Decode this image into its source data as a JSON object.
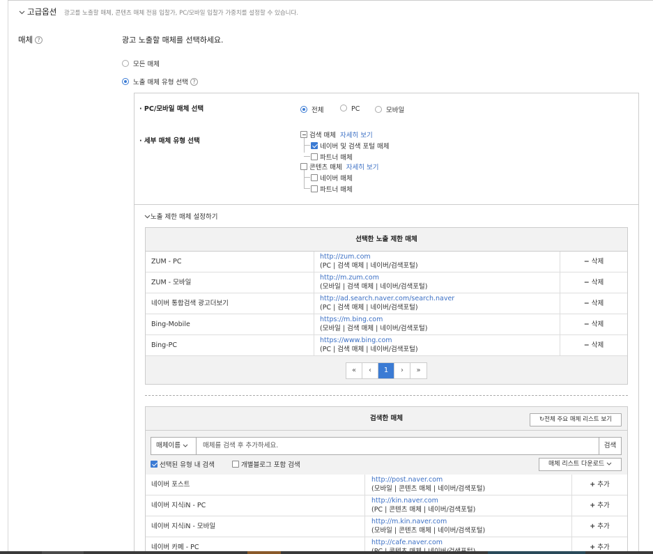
{
  "advanced": {
    "title": "고급옵션",
    "desc": "광고를 노출할 매체, 콘텐츠 매체 전용 입찰가, PC/모바일 입찰가 가중치를 설정할 수 있습니다."
  },
  "media": {
    "label": "매체",
    "prompt": "광고 노출할 매체를 선택하세요.",
    "option_all": "모든 매체",
    "option_type": "노출 매체 유형 선택"
  },
  "device": {
    "label": "· PC/모바일 매체 선택",
    "options": [
      "전체",
      "PC",
      "모바일"
    ],
    "selected": "전체"
  },
  "detail": {
    "label": "· 세부 매체 유형 선택",
    "search_media": "검색 매체",
    "search_link": "자세히 보기",
    "naver_search_portal": "네이버 및 검색 포털 매체",
    "partner_1": "파트너 매체",
    "content_media": "콘텐츠 매체",
    "content_link": "자세히 보기",
    "naver_media": "네이버 매체",
    "partner_2": "파트너 매체"
  },
  "limit": {
    "toggle": "노출 제한 매체 설정하기",
    "table_title": "선택한 노출 제한 매체",
    "delete_label": "삭제",
    "rows": [
      {
        "name": "ZUM - PC",
        "url": "http://zum.com",
        "sub": "(PC | 검색 매체 | 네이버/검색포털)"
      },
      {
        "name": "ZUM - 모바일",
        "url": "http://m.zum.com",
        "sub": "(모바일 | 검색 매체 | 네이버/검색포털)"
      },
      {
        "name": "네이버 통합검색 광고더보기",
        "url": "http://ad.search.naver.com/search.naver",
        "sub": "(PC | 검색 매체 | 네이버/검색포털)"
      },
      {
        "name": "Bing-Mobile",
        "url": "https://m.bing.com",
        "sub": "(모바일 | 검색 매체 | 네이버/검색포털)"
      },
      {
        "name": "Bing-PC",
        "url": "https://www.bing.com",
        "sub": "(PC | 검색 매체 | 네이버/검색포털)"
      }
    ],
    "pager": {
      "first": "«",
      "prev": "‹",
      "page": "1",
      "next": "›",
      "last": "»"
    }
  },
  "searched": {
    "title": "검색한 매체",
    "full_list_btn": "전체 주요 매체 리스트 보기",
    "select_value": "매체이름",
    "placeholder": "매체를 검색 후 추가하세요.",
    "search_btn": "검색",
    "opt_within": "선택된 유형 내 검색",
    "opt_blog": "개별블로그 포함 검색",
    "download_btn": "매체 리스트 다운로드",
    "add_label": "추가",
    "rows": [
      {
        "name": "네이버 포스트",
        "url": "http://post.naver.com",
        "sub": "(모바일 | 콘텐츠 매체 | 네이버/검색포털)"
      },
      {
        "name": "네이버 지식iN - PC",
        "url": "http://kin.naver.com",
        "sub": "(PC | 콘텐츠 매체 | 네이버/검색포털)"
      },
      {
        "name": "네이버 지식iN - 모바일",
        "url": "http://m.kin.naver.com",
        "sub": "(모바일 | 콘텐츠 매체 | 네이버/검색포털)"
      },
      {
        "name": "네이버 카페 - PC",
        "url": "http://cafe.naver.com",
        "sub": "(PC | 콘텐츠 매체 | 네이버/검색포털)"
      }
    ]
  },
  "colors": {
    "accent": "#3b7bd4",
    "link": "#3b6fc4"
  }
}
